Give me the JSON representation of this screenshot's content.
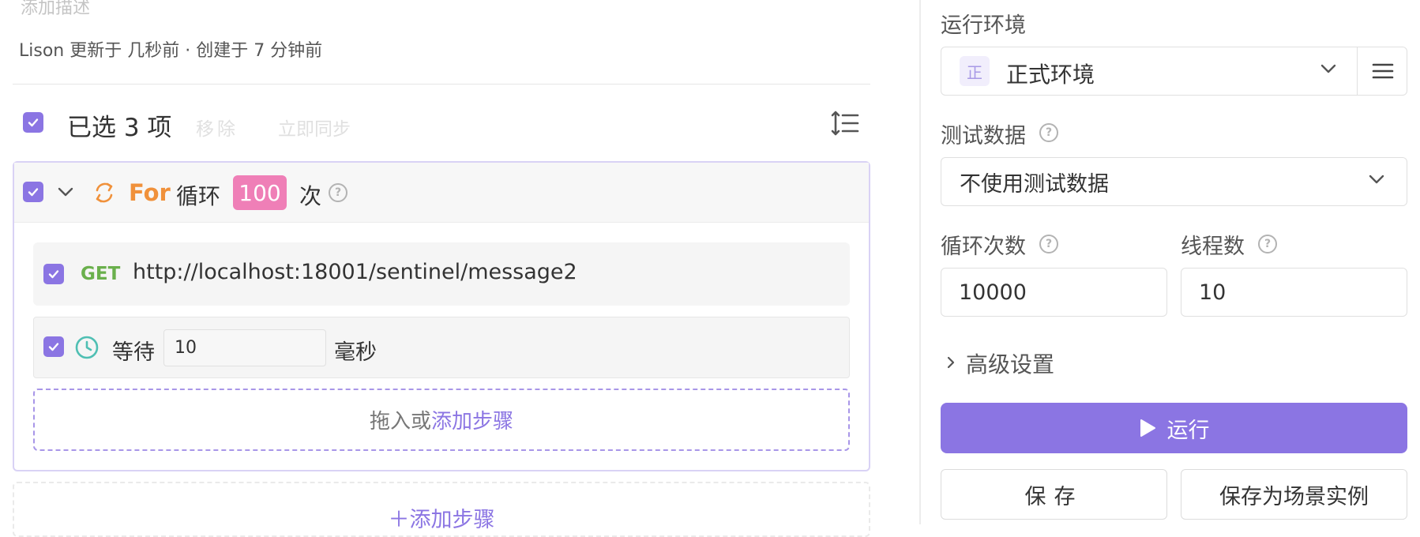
{
  "header": {
    "description_placeholder": "添加描述",
    "meta": "Lison 更新于 几秒前 · 创建于 7 分钟前"
  },
  "selection_bar": {
    "selected_text": "已选 3 项",
    "remove_label": "移除",
    "sync_label": "立即同步",
    "sort_icon": "sort-lines-icon"
  },
  "loop_block": {
    "keyword": "For",
    "loop_text": "循环",
    "count": "100",
    "times_text": "次",
    "accent_color": "#f0913b",
    "count_color": "#ef7fb7",
    "steps": {
      "request": {
        "method": "GET",
        "url": "http://localhost:18001/sentinel/message2"
      },
      "wait": {
        "label": "等待",
        "value": "10",
        "unit": "毫秒"
      }
    },
    "drop_zone": {
      "prefix": "拖入或",
      "link": "添加步骤"
    }
  },
  "add_step_label": "＋添加步骤",
  "run_panel": {
    "env_label": "运行环境",
    "env_badge": "正",
    "env_value": "正式环境",
    "test_data_label": "测试数据",
    "test_data_value": "不使用测试数据",
    "loop_count_label": "循环次数",
    "loop_count_value": "10000",
    "thread_count_label": "线程数",
    "thread_count_value": "10",
    "advanced_label": "高级设置",
    "run_label": "运行",
    "save_label": "保存",
    "save_as_label": "保存为场景实例",
    "primary_color": "#8b75e3"
  }
}
